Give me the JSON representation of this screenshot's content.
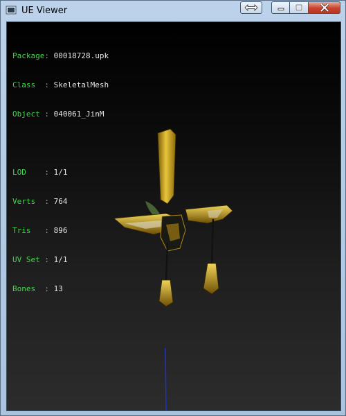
{
  "window": {
    "title": "UE Viewer",
    "controls": [
      "swap-view",
      "minimize",
      "maximize",
      "close"
    ]
  },
  "info": {
    "group1": [
      {
        "label": "Package:",
        "value": "00018728.upk"
      },
      {
        "label": "Class  :",
        "value": "SkeletalMesh"
      },
      {
        "label": "Object :",
        "value": "040061_JinM"
      }
    ],
    "group2": [
      {
        "label": "LOD    :",
        "value": "1/1"
      },
      {
        "label": "Verts  :",
        "value": "764"
      },
      {
        "label": "Tris   :",
        "value": "896"
      },
      {
        "label": "UV Set :",
        "value": "1/1"
      },
      {
        "label": "Bones  :",
        "value": "13"
      }
    ]
  },
  "colors": {
    "label": "#41d64a",
    "value": "#e6e6e6",
    "gold": "#c9a21a",
    "axis": "#1d2fd6"
  }
}
